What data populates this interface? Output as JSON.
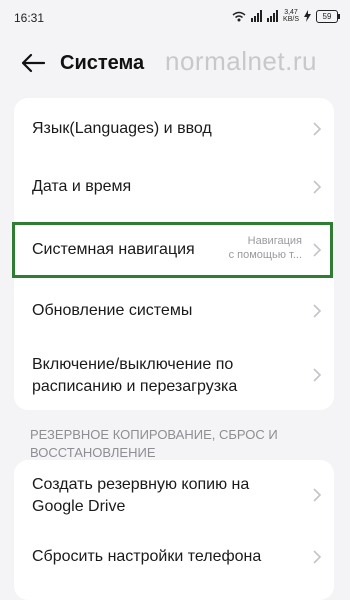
{
  "status_bar": {
    "time": "16:31",
    "speed_value": "3,47",
    "speed_unit": "KB/S",
    "battery": "59",
    "icons": [
      "wifi-icon",
      "signal-icon",
      "signal-icon",
      "charging-icon",
      "battery-icon"
    ]
  },
  "header": {
    "title": "Система",
    "watermark": "normalnet.ru"
  },
  "settings_card": {
    "items": [
      {
        "label": "Язык(Languages) и ввод",
        "value": ""
      },
      {
        "label": "Дата и время",
        "value": ""
      },
      {
        "label": "Системная навигация",
        "value_line1": "Навигация",
        "value_line2": "с помощью т..."
      },
      {
        "label": "Обновление системы",
        "value": ""
      },
      {
        "label_line1": "Включение/выключение по",
        "label_line2": "расписанию и перезагрузка"
      }
    ]
  },
  "backup_section": {
    "header_line1": "РЕЗЕРВНОЕ КОПИРОВАНИЕ, СБРОС И",
    "header_line2": "ВОССТАНОВЛЕНИЕ",
    "items": [
      {
        "label_line1": "Создать резервную копию на",
        "label_line2": "Google Drive"
      },
      {
        "label": "Сбросить настройки телефона"
      }
    ]
  },
  "colors": {
    "highlight_border": "#2e7d32",
    "background": "#f4f4f6",
    "card": "#ffffff"
  }
}
